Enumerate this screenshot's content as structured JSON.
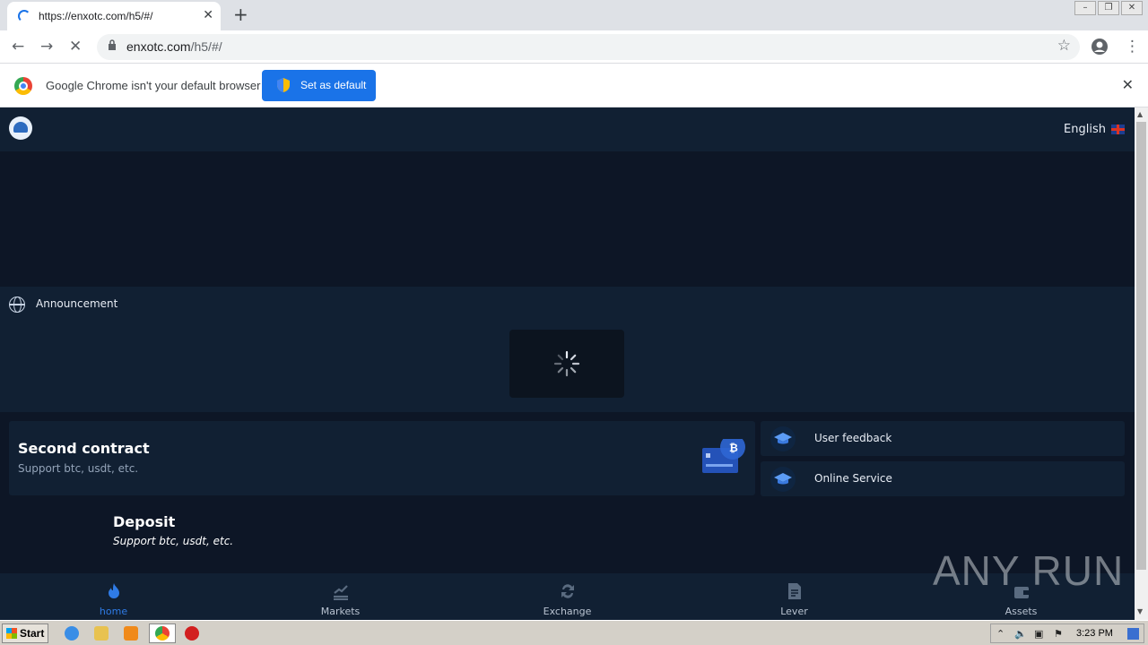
{
  "browser": {
    "tab_title": "https://enxotc.com/h5/#/",
    "url_host": "enxotc.com",
    "url_path": "/h5/#/",
    "infobar_message": "Google Chrome isn't your default browser",
    "set_default_label": "Set as default"
  },
  "app": {
    "language": "English",
    "announcement_label": "Announcement",
    "contract": {
      "title": "Second contract",
      "subtitle": "Support btc, usdt, etc."
    },
    "side_items": [
      {
        "label": "User feedback"
      },
      {
        "label": "Online Service"
      }
    ],
    "deposit": {
      "title": "Deposit",
      "subtitle": "Support btc, usdt, etc."
    },
    "nav": [
      {
        "label": "home",
        "icon": "flame-icon",
        "active": true
      },
      {
        "label": "Markets",
        "icon": "markets-icon"
      },
      {
        "label": "Exchange",
        "icon": "exchange-icon"
      },
      {
        "label": "Lever",
        "icon": "document-icon"
      },
      {
        "label": "Assets",
        "icon": "wallet-icon"
      }
    ],
    "accent_color": "#2f7be6"
  },
  "watermark": "ANY RUN",
  "taskbar": {
    "start_label": "Start",
    "clock": "3:23 PM"
  }
}
